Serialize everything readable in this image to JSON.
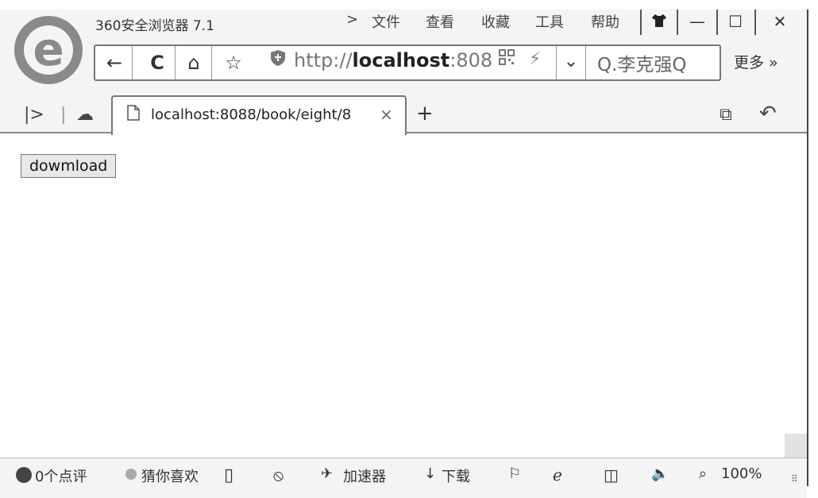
{
  "window": {
    "title": "360安全浏览器 7.1",
    "menu_arrow": ">",
    "menu": [
      "文件",
      "查看",
      "收藏",
      "工具",
      "帮助"
    ],
    "skin_icon": "shirt-icon",
    "minimize": "—",
    "maximize": "☐",
    "close": "✕"
  },
  "toolbar": {
    "back": "←",
    "refresh": "C",
    "home": "⌂",
    "favorite": "☆",
    "url_prefix": "http://",
    "url_host": "localhost",
    "url_rest": ":808",
    "dropdown": "⌄",
    "search_text": "Q.李克强Q",
    "more": "更多 »"
  },
  "tabs": {
    "sidebar_toggle": "|>",
    "cloud": "☁",
    "active_label": "localhost:8088/book/eight/8",
    "close": "×",
    "new_tab": "+",
    "restore": "⧉",
    "undo": "↶"
  },
  "page": {
    "button_label": "dowmload"
  },
  "status": {
    "reviews": "0个点评",
    "guess": "猜你喜欢",
    "accelerator": "加速器",
    "download": "下载",
    "zoom": "100%"
  }
}
